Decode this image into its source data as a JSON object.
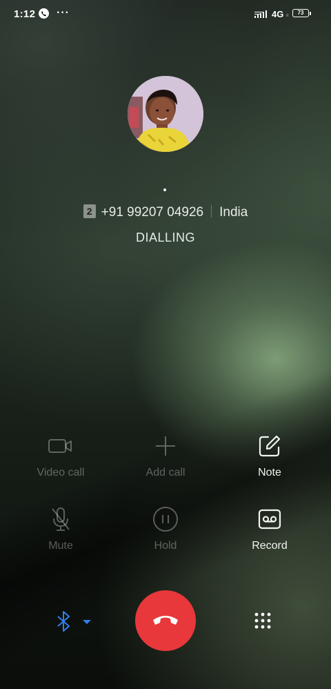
{
  "status_bar": {
    "time": "1:12",
    "more": "···",
    "network": "4G",
    "network_sub": "ıl",
    "battery": "73"
  },
  "caller": {
    "sim_slot": "2",
    "number": "+91 99207 04926",
    "location": "India",
    "state": "DIALLING"
  },
  "actions": {
    "video_call": "Video call",
    "add_call": "Add call",
    "note": "Note",
    "mute": "Mute",
    "hold": "Hold",
    "record": "Record"
  },
  "colors": {
    "end_call": "#e8383b",
    "bluetooth": "#2f80ed"
  },
  "icons": {
    "bluetooth": "bluetooth-icon",
    "end_call": "end-call-icon",
    "keypad": "keypad-icon"
  }
}
